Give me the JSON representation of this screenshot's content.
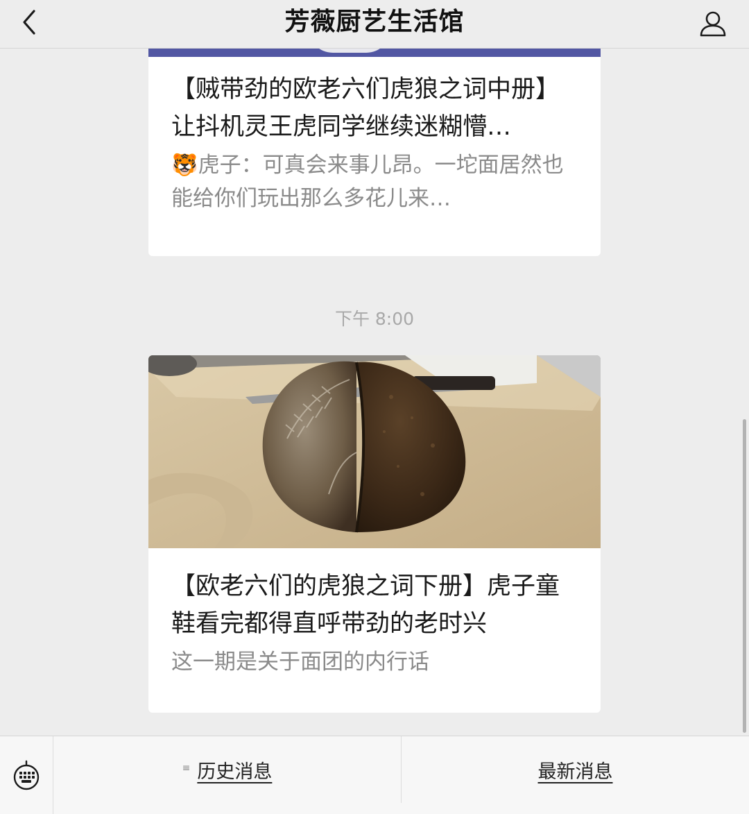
{
  "header": {
    "title": "芳薇厨艺生活馆",
    "back_icon": "chevron-left-icon",
    "profile_icon": "user-icon"
  },
  "articles": [
    {
      "title": "【贼带劲的欧老六们虎狼之词中册】让抖机灵王虎同学继续迷糊懵…",
      "digest": "🐯虎子：可真会来事儿昂。一坨面居然也能给你们玩出那么多花儿来…"
    },
    {
      "title": "【欧老六们的虎狼之词下册】虎子童鞋看完都得直呼带劲的老时兴",
      "digest": "这一期是关于面团的内行话"
    }
  ],
  "timestamp": "下午 8:00",
  "bottom_menu": {
    "keyboard_icon": "keyboard-icon",
    "items": [
      {
        "label": "历史消息",
        "icon": "≡"
      },
      {
        "label": "最新消息"
      }
    ]
  },
  "colors": {
    "background": "#ededed",
    "card": "#ffffff",
    "cover_strip": "#5257a3"
  }
}
